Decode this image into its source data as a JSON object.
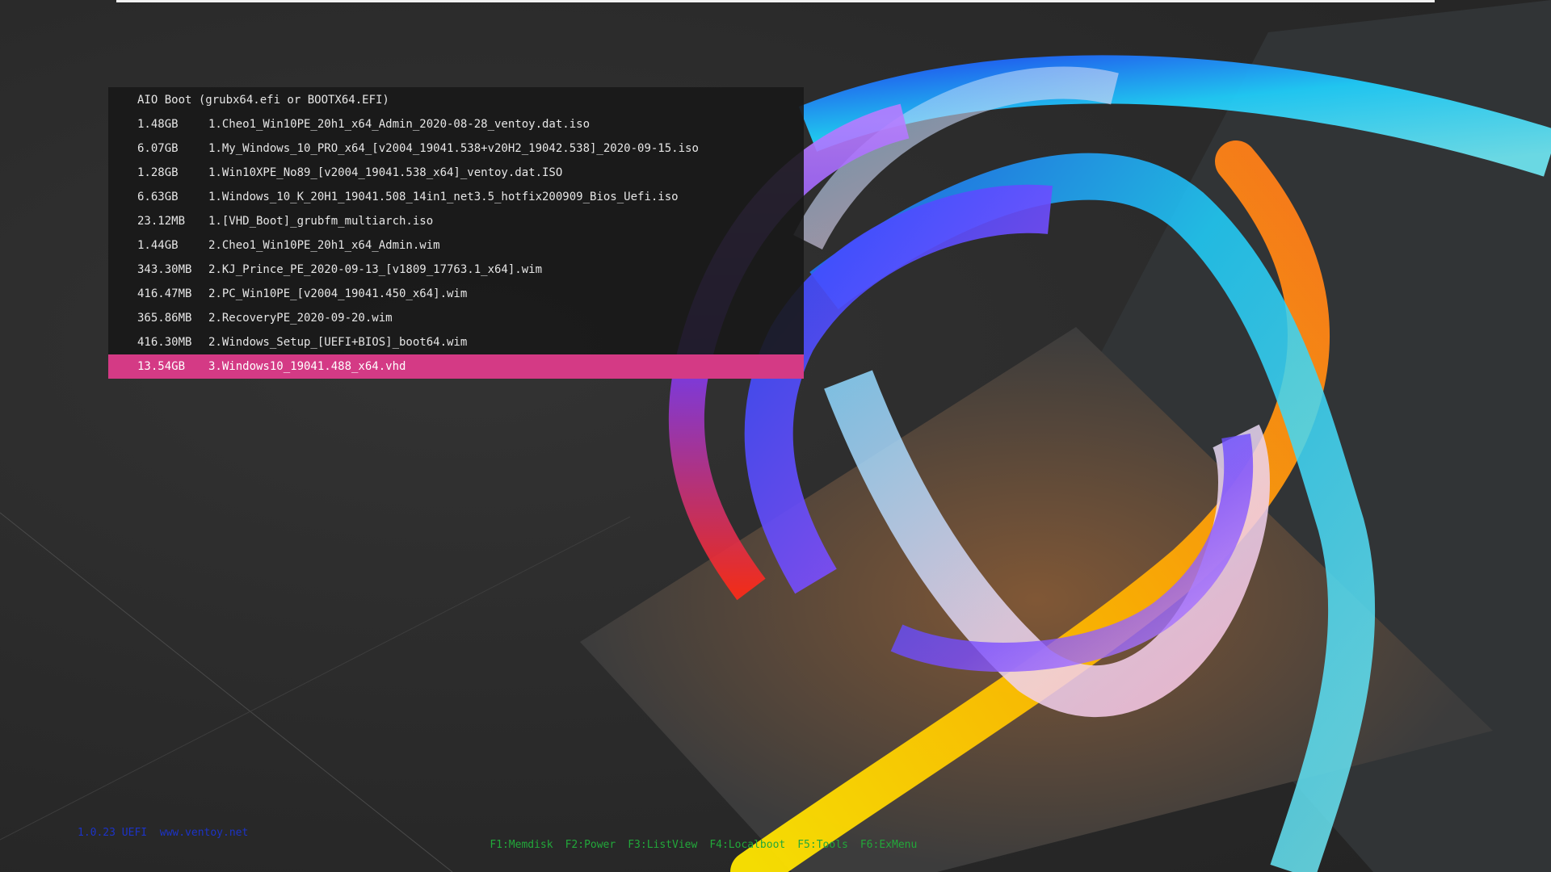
{
  "menu": {
    "title": "AIO Boot (grubx64.efi or BOOTX64.EFI)",
    "items": [
      {
        "size": "1.48GB",
        "name": "1.Cheo1_Win10PE_20h1_x64_Admin_2020-08-28_ventoy.dat.iso"
      },
      {
        "size": "6.07GB",
        "name": "1.My_Windows_10_PRO_x64_[v2004_19041.538+v20H2_19042.538]_2020-09-15.iso"
      },
      {
        "size": "1.28GB",
        "name": "1.Win10XPE_No89_[v2004_19041.538_x64]_ventoy.dat.ISO"
      },
      {
        "size": "6.63GB",
        "name": "1.Windows_10_K_20H1_19041.508_14in1_net3.5_hotfix200909_Bios_Uefi.iso"
      },
      {
        "size": "23.12MB",
        "name": "1.[VHD_Boot]_grubfm_multiarch.iso"
      },
      {
        "size": "1.44GB",
        "name": "2.Cheo1_Win10PE_20h1_x64_Admin.wim"
      },
      {
        "size": "343.30MB",
        "name": "2.KJ_Prince_PE_2020-09-13_[v1809_17763.1_x64].wim"
      },
      {
        "size": "416.47MB",
        "name": "2.PC_Win10PE_[v2004_19041.450_x64].wim"
      },
      {
        "size": "365.86MB",
        "name": "2.RecoveryPE_2020-09-20.wim"
      },
      {
        "size": "416.30MB",
        "name": "2.Windows_Setup_[UEFI+BIOS]_boot64.wim"
      },
      {
        "size": "13.54GB",
        "name": "3.Windows10_19041.488_x64.vhd"
      }
    ],
    "selected_index": 10
  },
  "status": {
    "version_text": "1.0.23 UEFI  www.ventoy.net"
  },
  "hotkeys": [
    "F1:Memdisk",
    "F2:Power",
    "F3:ListView",
    "F4:Localboot",
    "F5:Tools",
    "F6:ExMenu"
  ],
  "colors": {
    "selection": "#d43a85",
    "hotkey_text": "#22a83a",
    "version_text": "#1c33c7",
    "panel_bg": "#181818"
  }
}
